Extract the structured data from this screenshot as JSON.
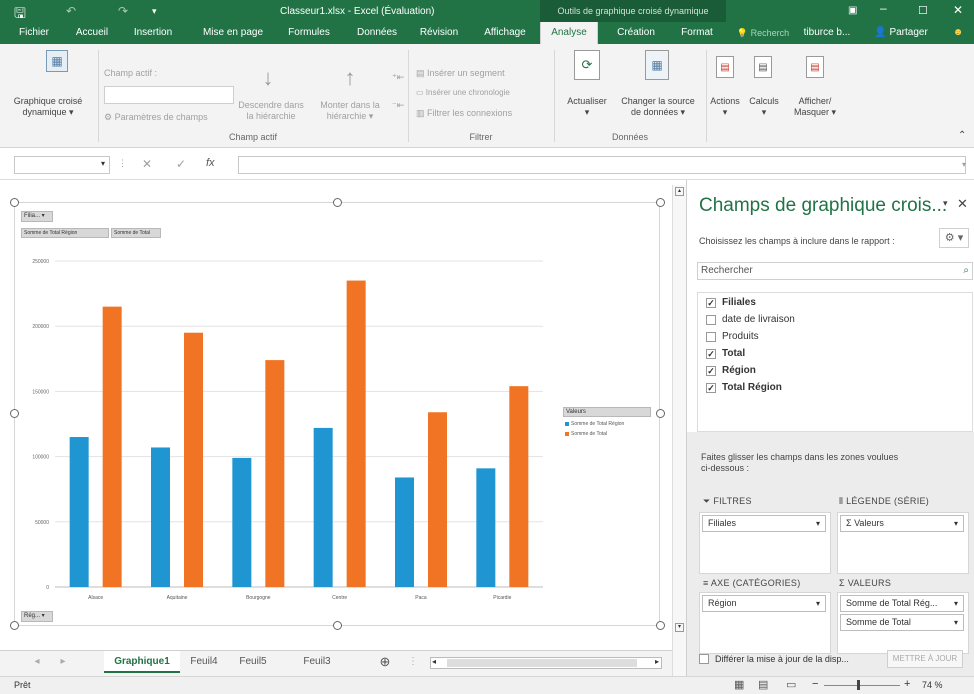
{
  "titlebar": {
    "title": "Classeur1.xlsx - Excel (Évaluation)",
    "context_title": "Outils de graphique croisé dynamique"
  },
  "tabs": [
    {
      "label": "Fichier"
    },
    {
      "label": "Accueil"
    },
    {
      "label": "Insertion"
    },
    {
      "label": "Mise en page"
    },
    {
      "label": "Formules"
    },
    {
      "label": "Données"
    },
    {
      "label": "Révision"
    },
    {
      "label": "Affichage"
    },
    {
      "label": "Analyse"
    },
    {
      "label": "Création"
    },
    {
      "label": "Format"
    }
  ],
  "tell_me": "Recherch",
  "user": "tiburce b...",
  "share_label": "Partager",
  "ribbon": {
    "pivotchart_label_1": "Graphique croisé",
    "pivotchart_label_2": "dynamique ▾",
    "active_field_label": "Champ actif :",
    "field_settings_label": "Paramètres de champs",
    "drill_down_1": "Descendre dans",
    "drill_down_2": "la hiérarchie",
    "drill_up_1": "Monter dans la",
    "drill_up_2": "hiérarchie ▾",
    "group_active_field": "Champ actif",
    "insert_slicer": "Insérer un segment",
    "insert_timeline": "Insérer une chronologie",
    "filter_connections": "Filtrer les connexions",
    "group_filter": "Filtrer",
    "refresh_label": "Actualiser",
    "change_source_1": "Changer la source",
    "change_source_2": "de données ▾",
    "group_data": "Données",
    "actions_label": "Actions",
    "calculations_label": "Calculs",
    "show_hide_1": "Afficher/",
    "show_hide_2": "Masquer ▾"
  },
  "formula_bar": {
    "fx": "fx"
  },
  "chart": {
    "filter_button": "Filia...",
    "legend_title": "Valeurs",
    "region_button": "Rég..."
  },
  "chart_data": {
    "type": "bar",
    "categories": [
      "Alsace",
      "Aquitaine",
      "Bourgogne",
      "Centre",
      "Paca",
      "Picardie"
    ],
    "series": [
      {
        "name": "Somme de Total Région",
        "color": "#1f96d1",
        "values": [
          115000,
          107000,
          99000,
          122000,
          84000,
          91000
        ]
      },
      {
        "name": "Somme de Total",
        "color": "#f07423",
        "values": [
          215000,
          195000,
          174000,
          235000,
          134000,
          154000
        ]
      }
    ],
    "ylim": [
      0,
      250000
    ],
    "yticks": [
      "0",
      "50000",
      "100000",
      "150000",
      "200000",
      "250000"
    ],
    "grid": true,
    "legend_position": "right",
    "value_buttons": [
      "Somme de Total Région",
      "Somme de Total"
    ]
  },
  "pane": {
    "title": "Champs de graphique crois...",
    "instruction": "Choisissez les champs à inclure dans le rapport :",
    "search_placeholder": "Rechercher",
    "fields": [
      {
        "label": "Filiales",
        "checked": true
      },
      {
        "label": "date de livraison",
        "checked": false
      },
      {
        "label": "Produits",
        "checked": false
      },
      {
        "label": "Total",
        "checked": true
      },
      {
        "label": "Région",
        "checked": true
      },
      {
        "label": "Total Région",
        "checked": true
      }
    ],
    "drag_hint_1": "Faites glisser les champs dans les zones voulues",
    "drag_hint_2": "ci-dessous :",
    "filters_label": "FILTRES",
    "legend_label": "LÉGENDE (SÉRIE)",
    "axis_label": "AXE (CATÉGORIES)",
    "values_label": "VALEURS",
    "filters_item": "Filiales",
    "legend_item": "Σ Valeurs",
    "axis_item": "Région",
    "values_items": [
      "Somme de Total Rég...",
      "Somme de Total"
    ],
    "defer_label": "Différer la mise à jour de la disp...",
    "update_button": "METTRE À JOUR"
  },
  "sheet_tabs": [
    "Graphique1",
    "Feuil4",
    "Feuil5",
    "Feuil3"
  ],
  "status": {
    "ready": "Prêt",
    "zoom": "74 %"
  }
}
